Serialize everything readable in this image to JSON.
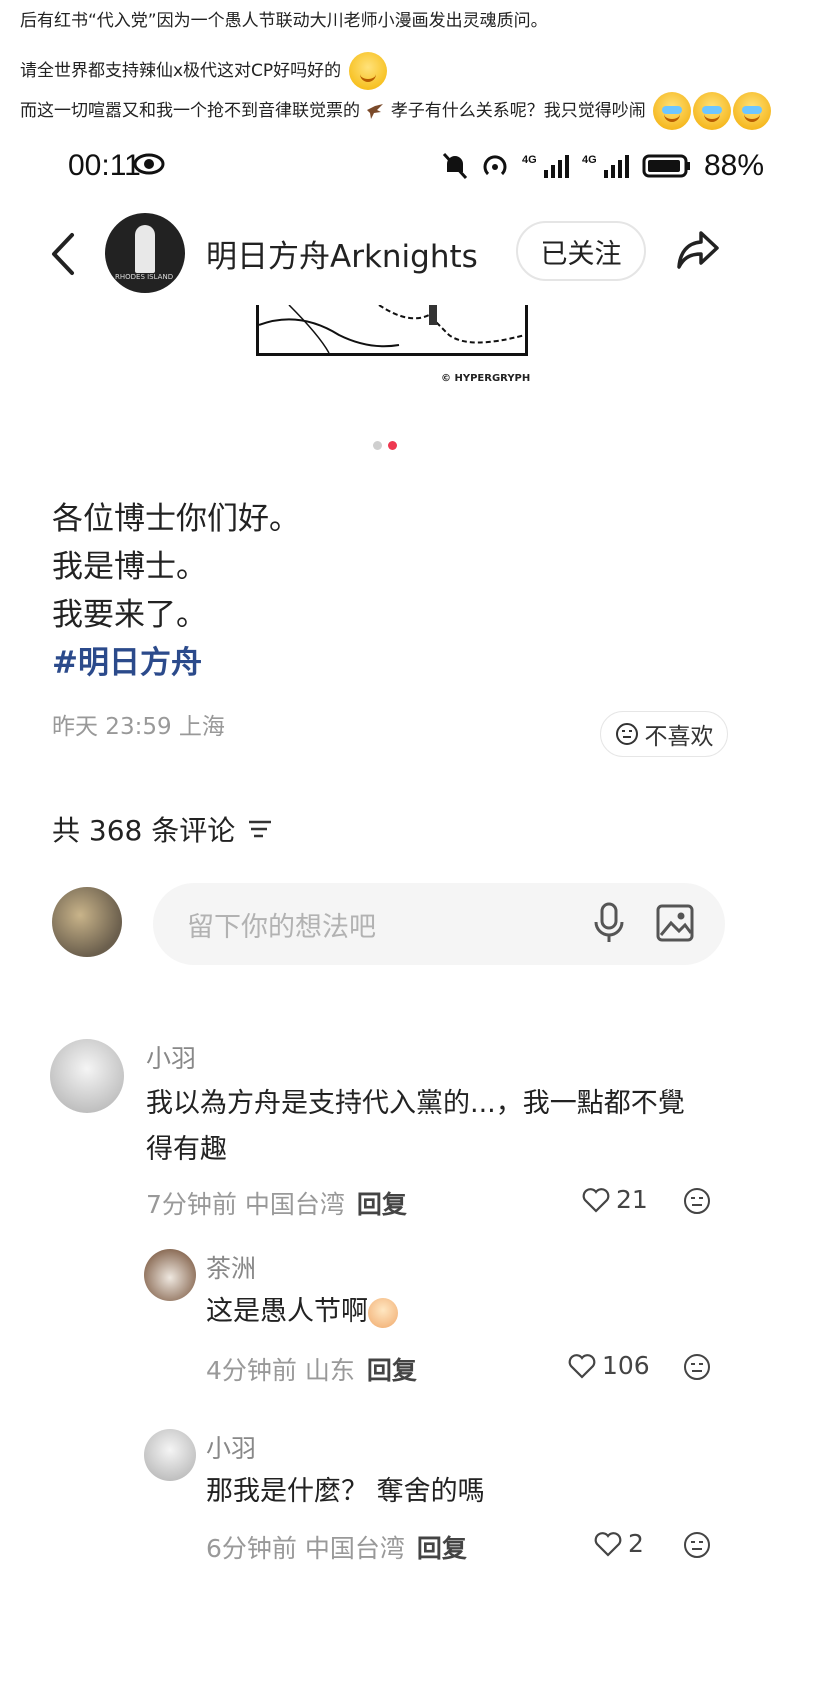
{
  "captions": {
    "line1": "后有红书“代入党”因为一个愚人节联动大川老师小漫画发出灵魂质问。",
    "line2": "请全世界都支持辣仙x极代这对CP好吗好的",
    "line3a": "而这一切喧嚣又和我一个抢不到音律联觉票的",
    "line3b": "孝子有什么关系呢？我只觉得吵闹"
  },
  "status_bar": {
    "time": "00:11",
    "network": "4G",
    "battery": "88%"
  },
  "header": {
    "account_name": "明日方舟Arknights",
    "follow_label": "已关注"
  },
  "post": {
    "copyright": "© HYPERGRYPH",
    "lines": [
      "各位博士你们好。",
      "我是博士。",
      "我要来了。"
    ],
    "hashtag": "#明日方舟",
    "meta": "昨天 23:59 上海",
    "dislike_label": "不喜欢"
  },
  "comments_header": {
    "count_text": "共 368 条评论"
  },
  "comment_input": {
    "placeholder": "留下你的想法吧"
  },
  "comments": [
    {
      "name": "小羽",
      "text_line1": "我以為方舟是支持代入黨的...，我一點都不覺",
      "text_line2": "得有趣",
      "meta": "7分钟前 中国台湾",
      "reply": "回复",
      "likes": "21"
    },
    {
      "name": "茶洲",
      "text": "这是愚人节啊",
      "meta": "4分钟前 山东",
      "reply": "回复",
      "likes": "106"
    },
    {
      "name": "小羽",
      "text": "那我是什麼？ 奪舍的嗎",
      "meta": "6分钟前 中国台湾",
      "reply": "回复",
      "likes": "2"
    }
  ],
  "colors": {
    "hashtag": "#2b4a8b",
    "active_dot": "#ee3850"
  }
}
